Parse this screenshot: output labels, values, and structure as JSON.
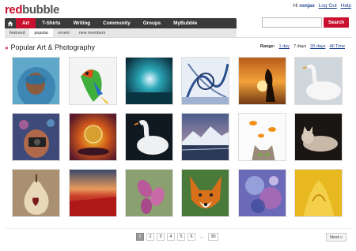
{
  "logo": {
    "red": "red",
    "gray": "bubble"
  },
  "userbar": {
    "greeting": "Hi",
    "username": "ronjax",
    "logout": "Log Out",
    "help": "Help"
  },
  "search": {
    "placeholder": "",
    "button": "Search"
  },
  "nav": {
    "home_icon": "home-icon",
    "items": [
      "Art",
      "T-Shirts",
      "Writing",
      "Community",
      "Groups",
      "MyBubble"
    ]
  },
  "subnav": {
    "items": [
      "featured",
      "popular",
      "recent",
      "new members"
    ]
  },
  "page_title": "Popular Art & Photography",
  "range": {
    "label": "Range:",
    "options": [
      "1 day",
      "7 days",
      "30 days",
      "All Time"
    ],
    "current": "7 days"
  },
  "gallery": [
    {
      "subject": "person in blue hood"
    },
    {
      "subject": "parrot"
    },
    {
      "subject": "underwater light"
    },
    {
      "subject": "ornate pattern"
    },
    {
      "subject": "silhouette sunset"
    },
    {
      "subject": "white swan"
    },
    {
      "subject": "person with camera"
    },
    {
      "subject": "water drop"
    },
    {
      "subject": "swan on dark water"
    },
    {
      "subject": "mountain landscape"
    },
    {
      "subject": "cat and goldfish"
    },
    {
      "subject": "cat"
    },
    {
      "subject": "pear with heart"
    },
    {
      "subject": "red tulip field"
    },
    {
      "subject": "purple flowers"
    },
    {
      "subject": "fox"
    },
    {
      "subject": "blue abstract"
    },
    {
      "subject": "yellow flower"
    }
  ],
  "pagination": {
    "pages": [
      "1",
      "2",
      "3",
      "4",
      "5",
      "6"
    ],
    "ellipsis": "...",
    "last": "30",
    "active": "1",
    "next": "Next »"
  },
  "colors": {
    "brand_red": "#c8102e",
    "nav_dark": "#3a3a3a",
    "link_blue": "#1a3f8f"
  }
}
